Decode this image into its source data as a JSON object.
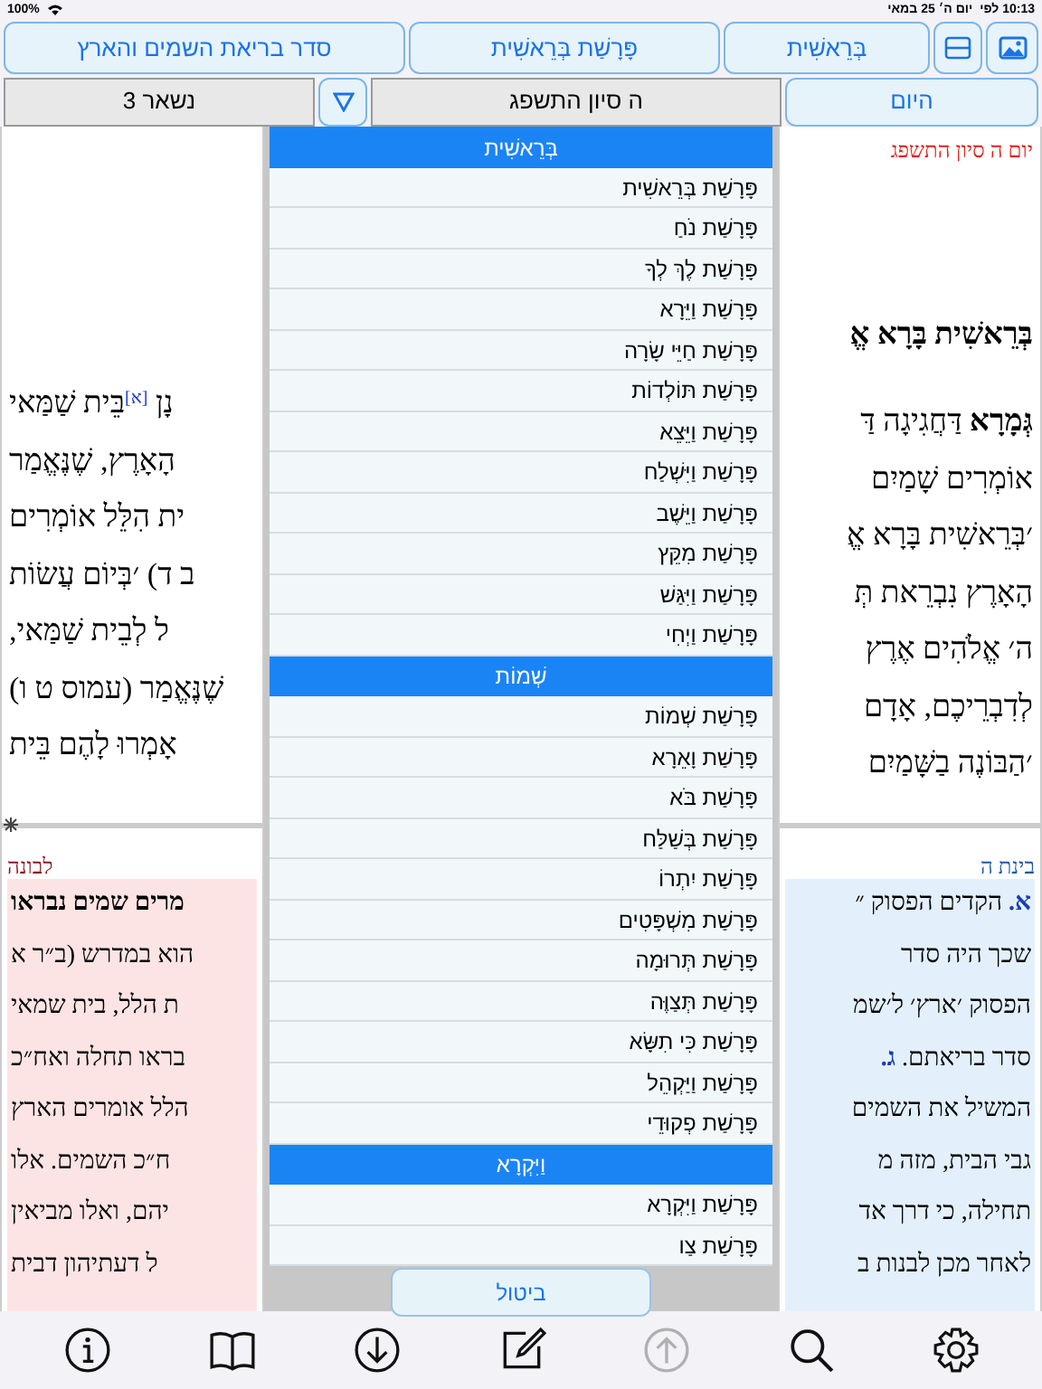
{
  "status_bar": {
    "time": "10:13 לפי",
    "date": "יום ה׳ 25 במאי",
    "battery": "100%"
  },
  "header_buttons": [
    "בְּרֵאשִׁית",
    "פָּרָשַׁת בְּרֵאשִׁית",
    "סדר בריאת השמים והארץ"
  ],
  "date_bar": {
    "today_button": "היום",
    "date_field": "ה סיון התשפג",
    "remaining": "נשאר 3"
  },
  "main_text": {
    "date": "יום ה סיון התשפג",
    "heading": "בְּרֵאשִׁית בָּרָא אֱ",
    "right_lines": [
      "**גְּמָרָא** דַּחֲגִיגָה דַּ",
      "אוֹמְרִים שָׁמַיִם",
      "׳בְּרֵאשִׁית בָּרָא אֱ",
      "הָאָרֶץ נִבְרֵאת תְּ",
      "ה׳ אֱלֹהִים אֶרֶץ",
      "לְדִבְרֵיכֶם, אָדָם",
      "׳הַבּוֹנֶה בַשָּׁמַיִם"
    ],
    "left_lines": [
      "נָן $^{[א]}$בֵּית שַׁמַּאי",
      "הָאָרֶץ, שֶׁנֶּאֱמַר",
      "ית הִלֵּל אוֹמְרִים",
      "ב ד) ׳בְּיוֹם עֲשׂוֹת",
      "ל לְבֵית שַׁמַּאי,",
      "שֶׁנֶּאֱמַר (עמוס ט ו)",
      "אָמְרוּ לָהֶם בֵּית"
    ]
  },
  "commentary_right": {
    "title": "בינת ה",
    "lines": [
      "**א.** הקדים הפסוק ״",
      "שכך היה סדר",
      "הפסוק ׳ארץ׳ ל׳שמ",
      "סדר בריאתם. **ג.**",
      "המשיל את השמים",
      "גבי הבית, מזה מ",
      "תחילה, כי דרך אד",
      "לאחר מכן לבנות ב"
    ]
  },
  "commentary_left": {
    "title": "לבונה",
    "lines": [
      "**מרים שמים נבראו**",
      "הוא במדרש (ב״ר א",
      "ת הלל, בית שמאי",
      "בראו תחלה ואח״כ",
      "הלל אומרים הארץ",
      "ח״כ השמים. אלו",
      "יהם, ואלו מביאין",
      "ל דעתיהון דבית"
    ]
  },
  "picker": {
    "sections": [
      {
        "title": "בְּרֵאשִׁית",
        "items": [
          "פָּרָשַׁת בְּרֵאשִׁית",
          "פָּרָשַׁת נֹחַ",
          "פָּרָשַׁת לֶךְ לְךָ",
          "פָּרָשַׁת וַיֵּרָא",
          "פָּרָשַׁת חַיֵּי שָׂרָה",
          "פָּרָשַׁת תּוֹלְדוֹת",
          "פָּרָשַׁת וַיֵּצֵא",
          "פָּרָשַׁת וַיִּשְׁלַח",
          "פָּרָשַׁת וַיֵּשֶׁב",
          "פָּרָשַׁת מִקֵּץ",
          "פָּרָשַׁת וַיִּגַּשׁ",
          "פָּרָשַׁת וַיְחִי"
        ]
      },
      {
        "title": "שְׁמוֹת",
        "items": [
          "פָּרָשַׁת שְׁמוֹת",
          "פָּרָשַׁת וָאֵרָא",
          "פָּרָשַׁת בֹּא",
          "פָּרָשַׁת בְּשַׁלַּח",
          "פָּרָשַׁת יִתְרוֹ",
          "פָּרָשַׁת מִשְׁפָּטִים",
          "פָּרָשַׁת תְּרוּמָה",
          "פָּרָשַׁת תְּצַוֶּה",
          "פָּרָשַׁת כִּי תִשָּׂא",
          "פָּרָשַׁת וַיַּקְהֵל",
          "פָּרָשַׁת פְקוּדֵי"
        ]
      },
      {
        "title": "וַיִּקְרָא",
        "items": [
          "פָּרָשַׁת וַיִּקְרָא",
          "פָּרָשַׁת צַו"
        ]
      }
    ],
    "cancel": "ביטול"
  },
  "bottom_toolbar": [
    {
      "kind": "info",
      "disabled": false
    },
    {
      "kind": "book",
      "disabled": false
    },
    {
      "kind": "download",
      "disabled": false
    },
    {
      "kind": "edit",
      "disabled": false
    },
    {
      "kind": "up",
      "disabled": true
    },
    {
      "kind": "search",
      "disabled": false
    },
    {
      "kind": "settings",
      "disabled": false
    }
  ]
}
